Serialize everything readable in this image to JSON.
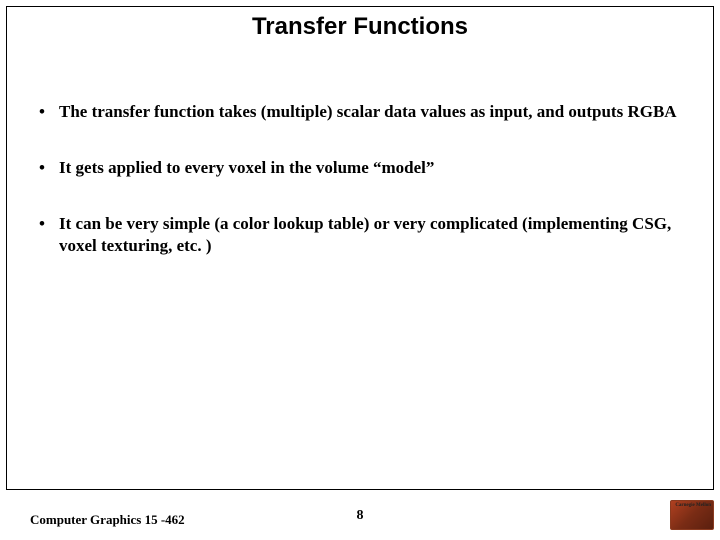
{
  "title": "Transfer Functions",
  "bullets": [
    "The transfer function takes (multiple) scalar data values as input, and outputs RGBA",
    "It gets applied to every voxel in the volume “model”",
    "It can be very simple (a color lookup table) or very complicated (implementing CSG, voxel texturing, etc. )"
  ],
  "footer": {
    "left": "Computer Graphics 15 -462",
    "page": "8",
    "logo_text": "Carnegie Mellon"
  }
}
